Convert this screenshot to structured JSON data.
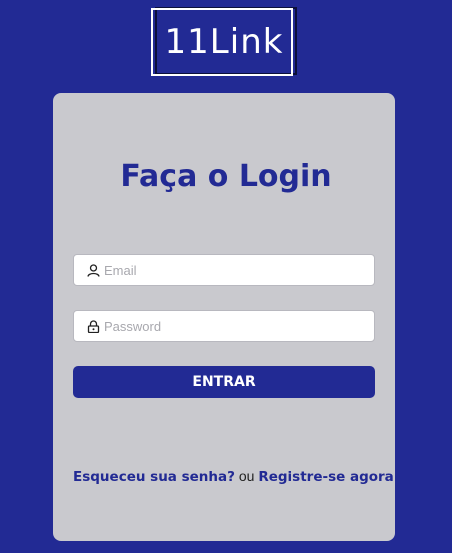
{
  "logo": {
    "text": "11Link"
  },
  "login": {
    "title": "Faça o Login",
    "email_placeholder": "Email",
    "password_placeholder": "Password",
    "submit_label": "ENTRAR"
  },
  "links": {
    "forgot_label": "Esqueceu sua senha?",
    "or_label": "ou",
    "register_label": "Registre-se agora!"
  },
  "icons": {
    "email": "user-icon",
    "password": "lock-icon"
  },
  "colors": {
    "background": "#222a94",
    "card": "#c9c9ce",
    "accent": "#222a94",
    "field": "#ffffff"
  }
}
